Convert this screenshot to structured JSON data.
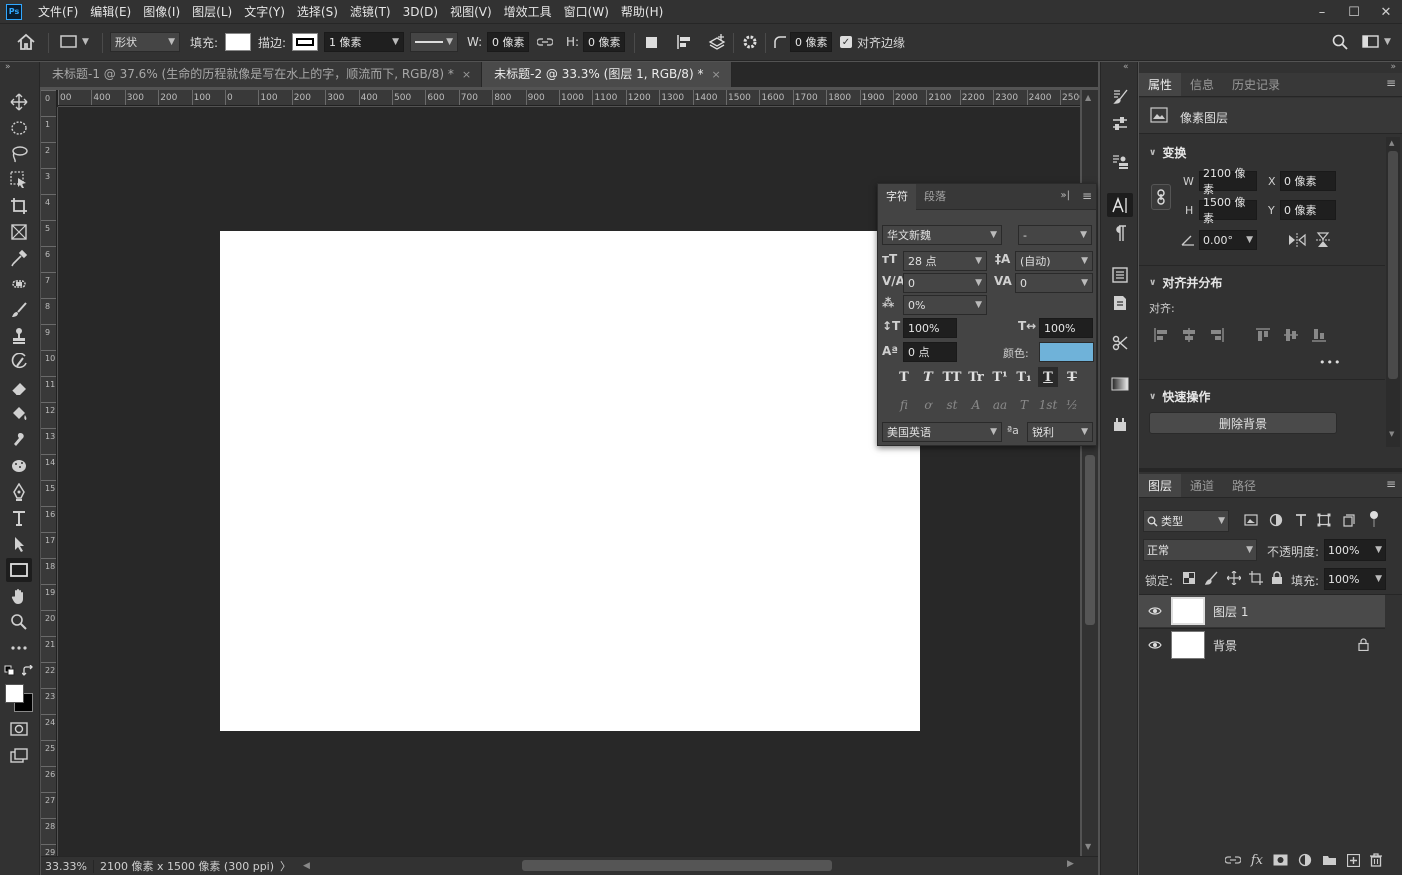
{
  "menubar": {
    "logo": "Ps",
    "items": [
      "文件(F)",
      "编辑(E)",
      "图像(I)",
      "图层(L)",
      "文字(Y)",
      "选择(S)",
      "滤镜(T)",
      "3D(D)",
      "视图(V)",
      "增效工具",
      "窗口(W)",
      "帮助(H)"
    ],
    "window_controls": [
      "–",
      "☐",
      "✕"
    ]
  },
  "options": {
    "shape_mode": "形状",
    "fill_label": "填充:",
    "stroke_label": "描边:",
    "stroke_width": "1 像素",
    "w_label": "W:",
    "w_value": "0 像素",
    "h_label": "H:",
    "h_value": "0 像素",
    "radius_value": "0 像素",
    "align_edges_label": "对齐边缘"
  },
  "tabs": [
    {
      "label": "未标题-1 @ 37.6% (生命的历程就像是写在水上的字，顺流而下, RGB/8) *",
      "close": "×"
    },
    {
      "label": "未标题-2 @ 33.3% (图层 1, RGB/8) *",
      "close": "×"
    }
  ],
  "ruler": {
    "h_ticks": [
      "00",
      "400",
      "300",
      "200",
      "100",
      "0",
      "100",
      "200",
      "300",
      "400",
      "500",
      "600",
      "700",
      "800",
      "900",
      "1000",
      "1100",
      "1200",
      "1300",
      "1400",
      "1500",
      "1600",
      "1700",
      "1800",
      "1900",
      "2000",
      "2100",
      "2200",
      "2300",
      "2400",
      "2500"
    ],
    "v_ticks": [
      "0",
      "1",
      "2",
      "3",
      "4",
      "5",
      "6",
      "7",
      "8",
      "9",
      "10",
      "11",
      "12",
      "13",
      "14",
      "15",
      "16",
      "17",
      "18",
      "19",
      "20",
      "21",
      "22",
      "23",
      "24",
      "25",
      "26",
      "27",
      "28",
      "29"
    ]
  },
  "status": {
    "zoom": "33.33%",
    "doc_info": "2100 像素 x 1500 像素 (300 ppi)",
    "arrow": "〉"
  },
  "character_panel": {
    "tabs": [
      "字符",
      "段落"
    ],
    "font_family": "华文新魏",
    "font_style": "-",
    "font_size": "28 点",
    "leading": "(自动)",
    "kerning": "0",
    "tracking": "0",
    "tsume": "0%",
    "vertical_scale": "100%",
    "horizontal_scale": "100%",
    "baseline_shift": "0 点",
    "color_label": "颜色:",
    "color_value": "#6fb2d9",
    "style_buttons_row1": [
      "T",
      "T",
      "TT",
      "Tr",
      "T¹",
      "T₁",
      "T",
      "T"
    ],
    "style_buttons_row2": [
      "fi",
      "ơ",
      "st",
      "A",
      "aa",
      "T",
      "1st",
      "½"
    ],
    "language": "美国英语",
    "aa_label": "ªa",
    "antialias": "锐利"
  },
  "properties_panel": {
    "tabs": [
      "属性",
      "信息",
      "历史记录"
    ],
    "layer_type": "像素图层",
    "transform_title": "变换",
    "w_label": "W",
    "w_value": "2100 像素",
    "x_label": "X",
    "x_value": "0 像素",
    "h_label": "H",
    "h_value": "1500 像素",
    "y_label": "Y",
    "y_value": "0 像素",
    "angle_value": "0.00°",
    "align_title": "对齐并分布",
    "align_label": "对齐:",
    "more": "•••",
    "quick_title": "快速操作",
    "remove_bg_button": "删除背景"
  },
  "layers_panel": {
    "tabs": [
      "图层",
      "通道",
      "路径"
    ],
    "filter_kind": "类型",
    "blend_mode": "正常",
    "opacity_label": "不透明度:",
    "opacity_value": "100%",
    "lock_label": "锁定:",
    "fill_label": "填充:",
    "fill_value": "100%",
    "layers": [
      {
        "name": "图层 1",
        "selected": true
      },
      {
        "name": "背景",
        "selected": false
      }
    ],
    "fx_label": "fx"
  },
  "colors": {
    "accent_blue": "#31a8ff",
    "char_color_swatch": "#6fb2d9",
    "canvas_bg": "#282828"
  }
}
